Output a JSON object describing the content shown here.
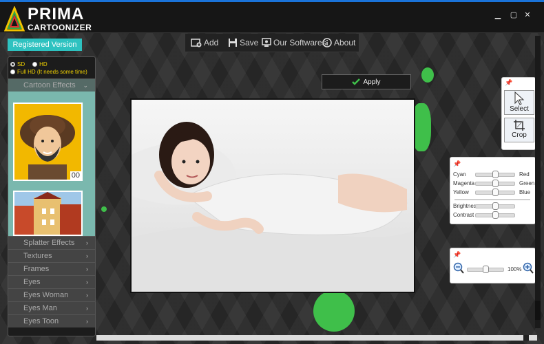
{
  "app": {
    "logo_line1": "PRIMA",
    "logo_line2": "CARTOONIZER",
    "accent": "#2ec2c0",
    "brand_green": "#3fbf4a",
    "window_controls": {
      "minimize": "▁",
      "maximize": "▢",
      "close": "✕"
    }
  },
  "toolbar": {
    "add": "Add",
    "save": "Save",
    "softwares": "Our Softwares",
    "about": "About"
  },
  "left": {
    "registered": "Registered Version",
    "quality": {
      "sd": "SD",
      "hd": "HD",
      "fullhd": "Full HD (It needs some time)",
      "selected": "SD"
    },
    "active_category": "Cartoon Effects",
    "thumb_count": "00",
    "categories": [
      "Splatter Effects",
      "Textures",
      "Frames",
      "Eyes",
      "Eyes Woman",
      "Eyes Man",
      "Eyes Toon"
    ]
  },
  "canvas": {
    "apply": "Apply"
  },
  "tools": {
    "select": "Select",
    "crop": "Crop"
  },
  "color": {
    "left_labels": [
      "Cyan",
      "Magenta",
      "Yellow"
    ],
    "right_labels": [
      "Red",
      "Green",
      "Blue"
    ],
    "levels": [
      0.5,
      0.5,
      0.5
    ],
    "brightness": "Brightness",
    "contrast": "Contrast",
    "brightness_level": 0.5,
    "contrast_level": 0.5
  },
  "zoom": {
    "value": "100%",
    "level": 0.5
  }
}
